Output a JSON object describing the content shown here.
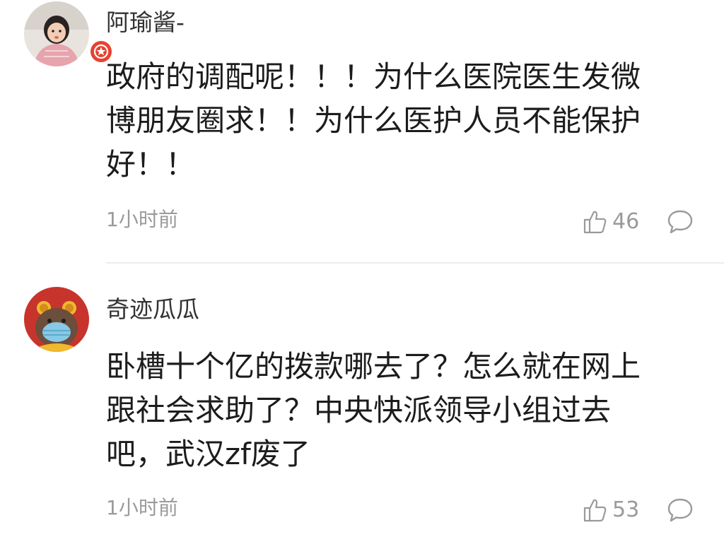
{
  "comments": [
    {
      "username": "阿瑜酱-",
      "lines": [
        "政府的调配呢！！！为什么医院医生发微",
        "博朋友圈求！！为什么医护人员不能保护",
        "好！！"
      ],
      "time": "1小时前",
      "likes": "46",
      "verified_badge": true
    },
    {
      "username": "奇迹瓜瓜",
      "lines": [
        "卧槽十个亿的拨款哪去了？怎么就在网上",
        "跟社会求助了？中央快派领导小组过去",
        "吧，武汉zf废了"
      ],
      "time": "1小时前",
      "likes": "53",
      "verified_badge": false
    }
  ],
  "colors": {
    "badge": "#e8412f",
    "secondary_text": "#9a9a9a",
    "divider": "#ececec"
  },
  "icons": [
    "thumbs-up-icon",
    "reply-icon",
    "verified-badge-icon"
  ]
}
